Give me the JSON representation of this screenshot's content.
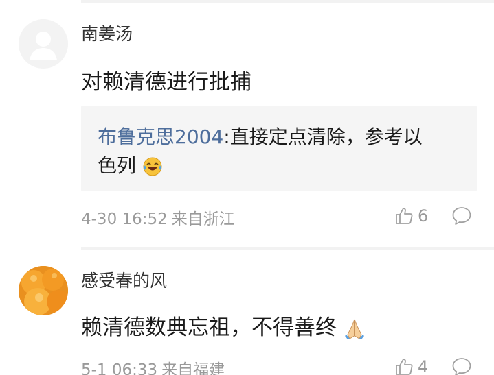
{
  "comments": [
    {
      "username": "南姜汤",
      "text": "对赖清德进行批捕",
      "reply": {
        "author": "布鲁克思2004",
        "separator": ":",
        "line1": "直接定点清除，参考以",
        "line2": "色列",
        "emoji": "laughing-tears-emoji"
      },
      "date": "4-30 16:52",
      "location": "来自浙江",
      "likes": "6"
    },
    {
      "username": "感受春的风",
      "text": "赖清德数典忘祖，不得善终",
      "emoji": "praying-hands-emoji",
      "date": "5-1 06:33",
      "location": "来自福建",
      "likes": "4"
    }
  ],
  "icons": {
    "like": "thumbs-up-icon",
    "comment": "comment-bubble-icon"
  },
  "colors": {
    "link_blue": "#4e6e9c",
    "meta_gray": "#9a9a9a",
    "reply_bg": "#f5f5f5"
  }
}
